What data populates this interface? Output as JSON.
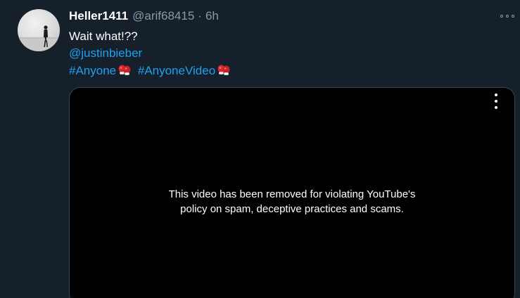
{
  "tweet": {
    "author_name": "Heller1411",
    "handle": "@arif68415",
    "separator": "·",
    "time": "6h",
    "text": "Wait what!??",
    "mention": "@justinbieber",
    "hashtags": [
      "#Anyone",
      "#AnyoneVideo"
    ],
    "more_icon": "more-horizontal-icon",
    "hashtag_emoji_icon": "boxing-gloves-icon"
  },
  "video": {
    "message_line1": "This video has been removed for violating YouTube's",
    "message_line2": "policy on spam, deceptive practices and scams.",
    "menu_icon": "more-vertical-icon"
  },
  "colors": {
    "background": "#15202b",
    "link": "#1da1f2",
    "secondary_text": "#8899a6",
    "video_background": "#000000"
  }
}
